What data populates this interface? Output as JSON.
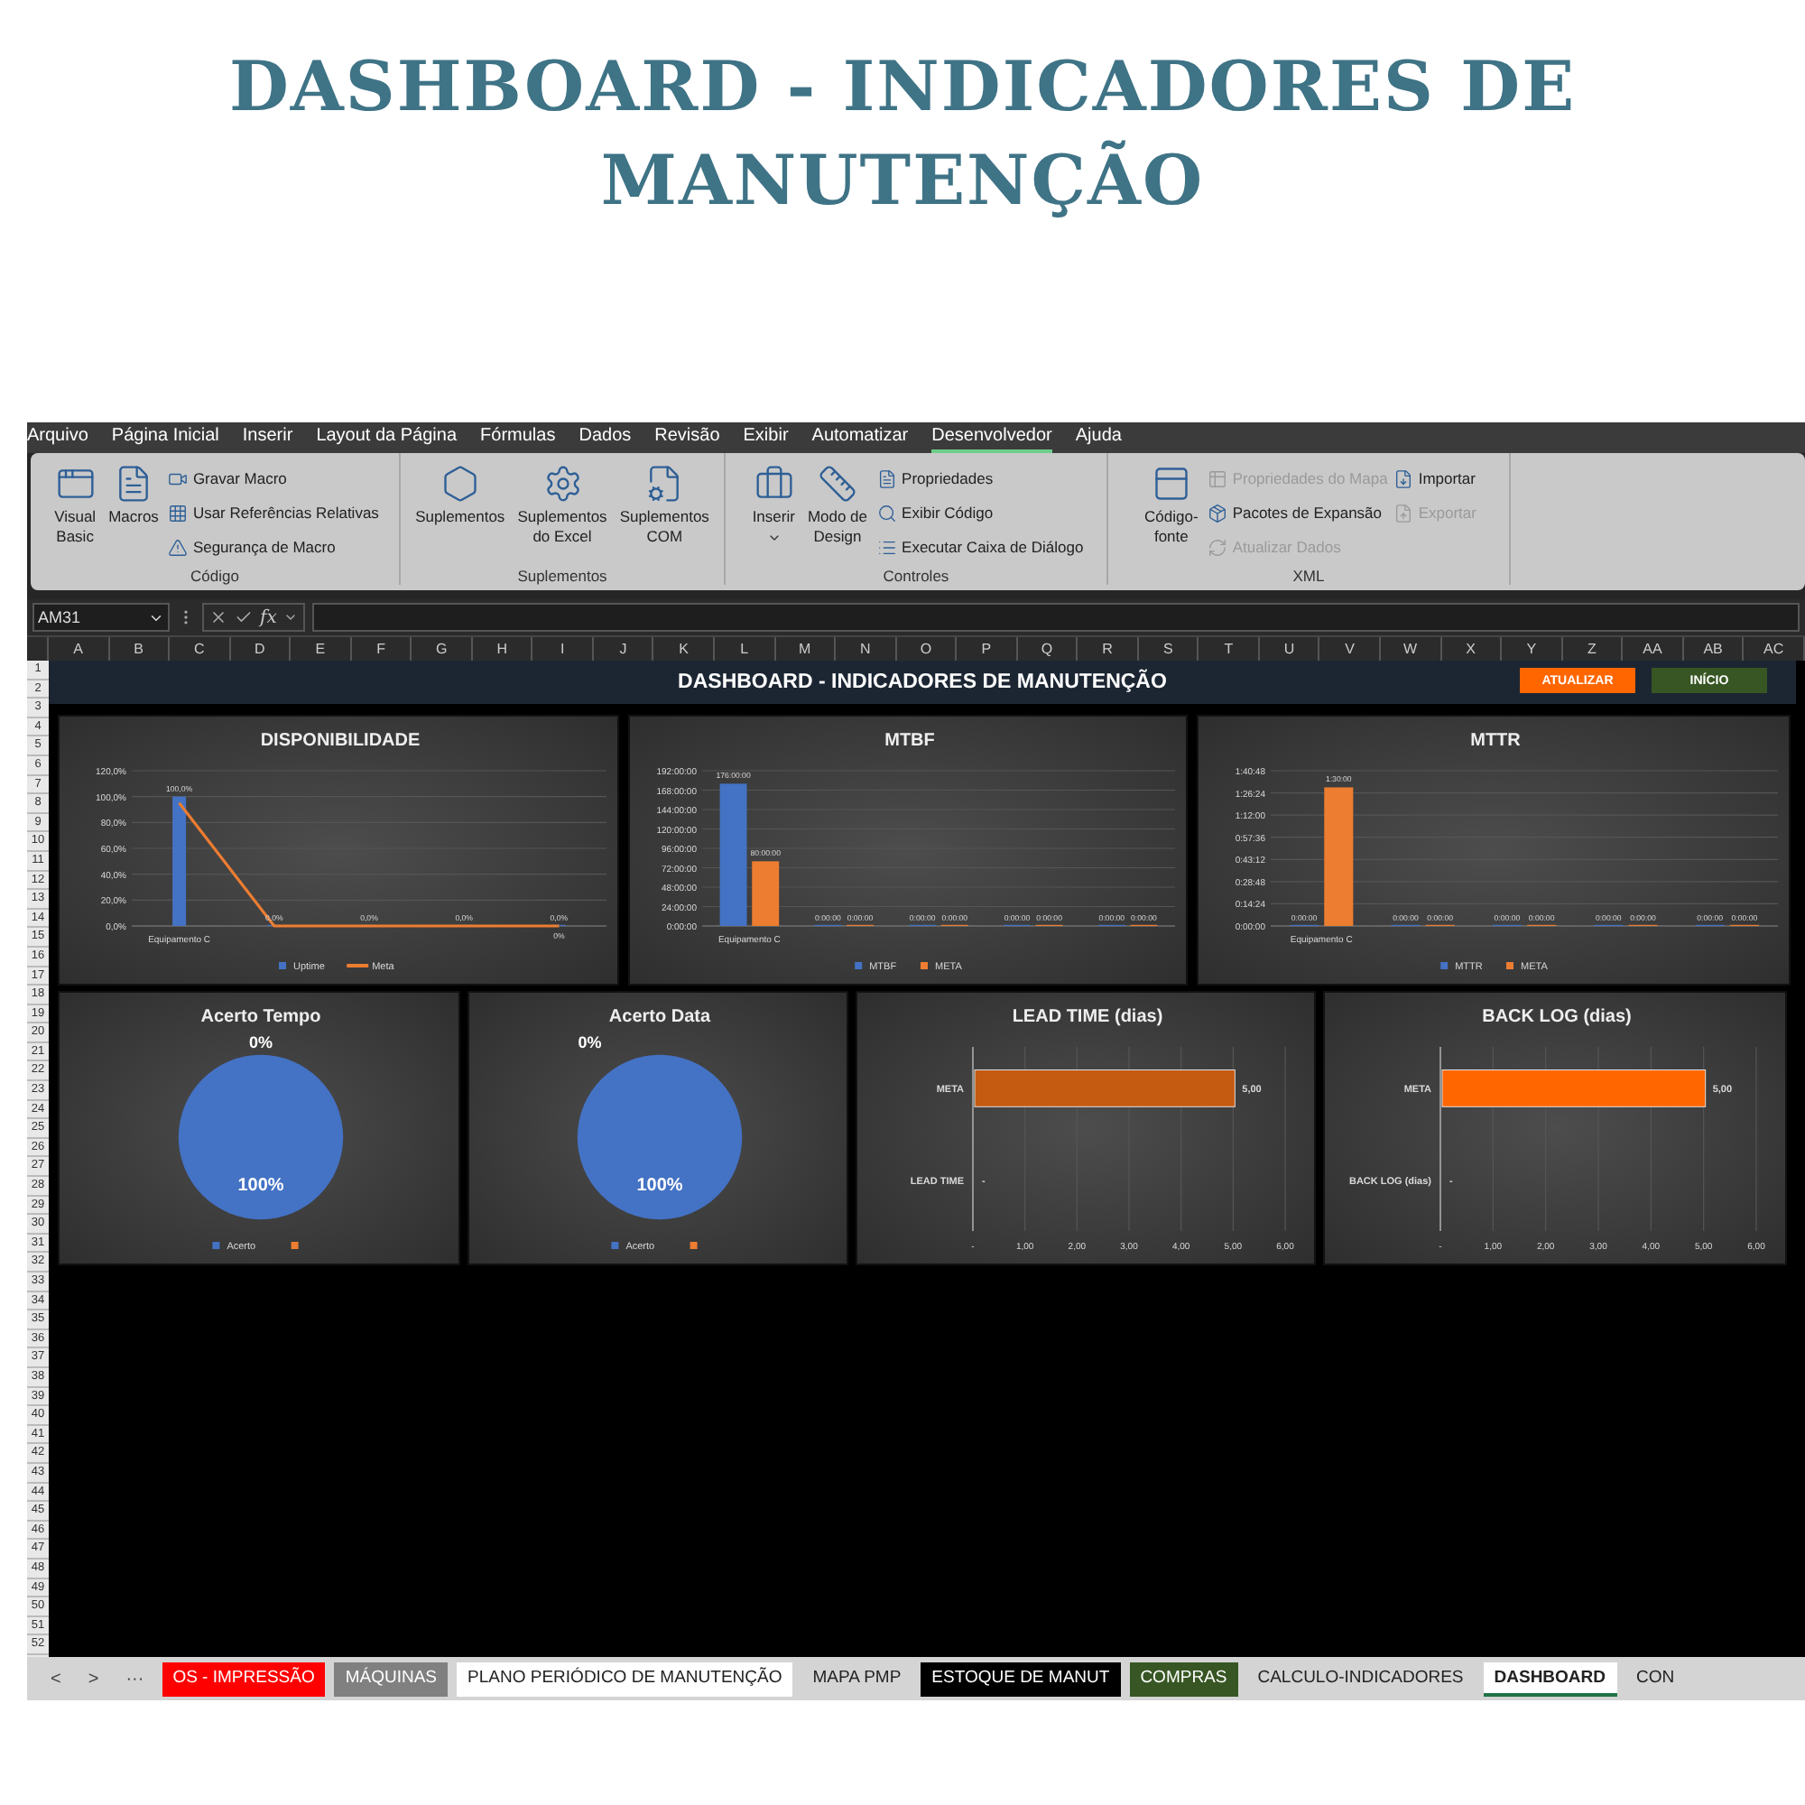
{
  "page_title": "DASHBOARD - INDICADORES DE MANUTENÇÃO",
  "menu_tabs": [
    {
      "label": "Arquivo",
      "selected": false
    },
    {
      "label": "Página Inicial",
      "selected": false
    },
    {
      "label": "Inserir",
      "selected": false
    },
    {
      "label": "Layout da Página",
      "selected": false
    },
    {
      "label": "Fórmulas",
      "selected": false
    },
    {
      "label": "Dados",
      "selected": false
    },
    {
      "label": "Revisão",
      "selected": false
    },
    {
      "label": "Exibir",
      "selected": false
    },
    {
      "label": "Automatizar",
      "selected": false
    },
    {
      "label": "Desenvolvedor",
      "selected": true
    },
    {
      "label": "Ajuda",
      "selected": false
    }
  ],
  "ribbon_groups": [
    {
      "label": "Código",
      "large": [
        {
          "label_lines": [
            "Visual",
            "Basic"
          ],
          "dropdown": false
        },
        {
          "label_lines": [
            "Macros"
          ],
          "dropdown": false
        }
      ],
      "small_columns": [
        [
          {
            "label": "Gravar Macro",
            "disabled": false
          },
          {
            "label": "Usar Referências Relativas",
            "disabled": false
          },
          {
            "label": "Segurança de Macro",
            "disabled": false
          }
        ]
      ]
    },
    {
      "label": "Suplementos",
      "large": [
        {
          "label_lines": [
            "Suplementos"
          ],
          "dropdown": false
        },
        {
          "label_lines": [
            "Suplementos",
            "do Excel"
          ],
          "dropdown": false
        },
        {
          "label_lines": [
            "Suplementos",
            "COM"
          ],
          "dropdown": false
        }
      ]
    },
    {
      "label": "Controles",
      "large": [
        {
          "label_lines": [
            "Inserir"
          ],
          "dropdown": true
        },
        {
          "label_lines": [
            "Modo de",
            "Design"
          ],
          "dropdown": false
        }
      ],
      "small_columns": [
        [
          {
            "label": "Propriedades",
            "disabled": false
          },
          {
            "label": "Exibir Código",
            "disabled": false
          },
          {
            "label": "Executar Caixa de Diálogo",
            "disabled": false
          }
        ]
      ]
    },
    {
      "label": "XML",
      "large": [
        {
          "label_lines": [
            "Código-",
            "fonte"
          ],
          "dropdown": false
        }
      ],
      "small_columns": [
        [
          {
            "label": "Propriedades do Mapa",
            "disabled": true
          },
          {
            "label": "Pacotes de Expansão",
            "disabled": false
          },
          {
            "label": "Atualizar Dados",
            "disabled": true
          }
        ],
        [
          {
            "label": "Importar",
            "disabled": false
          },
          {
            "label": "Exportar",
            "disabled": true
          }
        ]
      ]
    }
  ],
  "formula_bar": {
    "name_box": "AM31",
    "function_label": "fx"
  },
  "column_headers": [
    "A",
    "B",
    "C",
    "D",
    "E",
    "F",
    "G",
    "H",
    "I",
    "J",
    "K",
    "L",
    "M",
    "N",
    "O",
    "P",
    "Q",
    "R",
    "S",
    "T",
    "U",
    "V",
    "W",
    "X",
    "Y",
    "Z",
    "AA",
    "AB",
    "AC"
  ],
  "row_headers": [
    "1",
    "2",
    "3",
    "4",
    "5",
    "6",
    "7",
    "8",
    "9",
    "10",
    "11",
    "12",
    "13",
    "14",
    "15",
    "16",
    "17",
    "18",
    "19",
    "20",
    "21",
    "22",
    "23",
    "24",
    "25",
    "26",
    "27",
    "28",
    "29",
    "30",
    "31",
    "32",
    "33",
    "34",
    "35",
    "36",
    "37",
    "38",
    "39",
    "40",
    "41",
    "42",
    "43",
    "44",
    "45",
    "46",
    "47",
    "48",
    "49",
    "50",
    "51",
    "52"
  ],
  "sheet_title": "DASHBOARD - INDICADORES DE MANUTENÇÃO",
  "sheet_buttons": [
    {
      "label": "ATUALIZAR",
      "color": "#ff6600"
    },
    {
      "label": "INÍCIO",
      "color": "#375623"
    }
  ],
  "charts": [
    {
      "chart_data": {
        "type": "bar",
        "title": "DISPONIBILIDADE",
        "grid": true,
        "legend": "bottom",
        "categories": [
          "Equipamento C",
          null,
          null,
          null,
          null
        ],
        "ylim": [
          0,
          120
        ],
        "yticks": [
          {
            "value": 0,
            "label": "0,0%"
          },
          {
            "value": 20,
            "label": "20,0%"
          },
          {
            "value": 40,
            "label": "40,0%"
          },
          {
            "value": 60,
            "label": "60,0%"
          },
          {
            "value": 80,
            "label": "80,0%"
          },
          {
            "value": 100,
            "label": "100,0%"
          },
          {
            "value": 120,
            "label": "120,0%"
          }
        ],
        "series": [
          {
            "name": "Uptime",
            "type": "bar",
            "color": "#4472c4",
            "values": [
              100,
              0,
              0,
              0,
              0
            ],
            "value_labels": [
              "100,0%",
              "0,0%",
              "0,0%",
              "0,0%",
              "0,0%"
            ]
          },
          {
            "name": "Meta",
            "type": "line",
            "color": "#ed7d31",
            "values": [
              95,
              0,
              0,
              0,
              0
            ],
            "value_labels": [
              null,
              null,
              null,
              null,
              "0%"
            ]
          }
        ]
      }
    },
    {
      "chart_data": {
        "type": "bar",
        "title": "MTBF",
        "grid": true,
        "legend": "bottom",
        "categories": [
          "Equipamento C",
          null,
          null,
          null,
          null
        ],
        "ylim": [
          0,
          192
        ],
        "yticks": [
          {
            "value": 0,
            "label": "0:00:00"
          },
          {
            "value": 24,
            "label": "24:00:00"
          },
          {
            "value": 48,
            "label": "48:00:00"
          },
          {
            "value": 72,
            "label": "72:00:00"
          },
          {
            "value": 96,
            "label": "96:00:00"
          },
          {
            "value": 120,
            "label": "120:00:00"
          },
          {
            "value": 144,
            "label": "144:00:00"
          },
          {
            "value": 168,
            "label": "168:00:00"
          },
          {
            "value": 192,
            "label": "192:00:00"
          }
        ],
        "series": [
          {
            "name": "MTBF",
            "color": "#4472c4",
            "values": [
              176,
              0,
              0,
              0,
              0
            ],
            "value_labels": [
              "176:00:00",
              "0:00:00",
              "0:00:00",
              "0:00:00",
              "0:00:00"
            ]
          },
          {
            "name": "META",
            "color": "#ed7d31",
            "values": [
              80,
              0,
              0,
              0,
              0
            ],
            "value_labels": [
              "80:00:00",
              "0:00:00",
              "0:00:00",
              "0:00:00",
              "0:00:00"
            ]
          }
        ]
      }
    },
    {
      "chart_data": {
        "type": "bar",
        "title": "MTTR",
        "grid": true,
        "legend": "bottom",
        "categories": [
          "Equipamento C",
          null,
          null,
          null,
          null
        ],
        "ylim": [
          0,
          100.8
        ],
        "yticks": [
          {
            "value": 0,
            "label": "0:00:00"
          },
          {
            "value": 14.4,
            "label": "0:14:24"
          },
          {
            "value": 28.8,
            "label": "0:28:48"
          },
          {
            "value": 43.2,
            "label": "0:43:12"
          },
          {
            "value": 57.6,
            "label": "0:57:36"
          },
          {
            "value": 72,
            "label": "1:12:00"
          },
          {
            "value": 86.4,
            "label": "1:26:24"
          },
          {
            "value": 100.8,
            "label": "1:40:48"
          }
        ],
        "series": [
          {
            "name": "MTTR",
            "color": "#4472c4",
            "values": [
              0,
              0,
              0,
              0,
              0
            ],
            "value_labels": [
              "0:00:00",
              "0:00:00",
              "0:00:00",
              "0:00:00",
              "0:00:00"
            ]
          },
          {
            "name": "META",
            "color": "#ed7d31",
            "values": [
              90,
              0,
              0,
              0,
              0
            ],
            "value_labels": [
              "1:30:00",
              "0:00:00",
              "0:00:00",
              "0:00:00",
              "0:00:00"
            ]
          }
        ]
      }
    },
    {
      "chart_data": {
        "type": "pie",
        "title": "Acerto Tempo",
        "legend": "bottom",
        "categories": [
          "Acerto",
          null
        ],
        "values": [
          100,
          0
        ],
        "colors": [
          "#4472c4",
          "#ed7d31"
        ],
        "value_labels": [
          "100%",
          "0%"
        ]
      }
    },
    {
      "chart_data": {
        "type": "pie",
        "title": "Acerto Data",
        "legend": "bottom",
        "categories": [
          "Acerto",
          null
        ],
        "values": [
          100,
          0
        ],
        "colors": [
          "#4472c4",
          "#ed7d31"
        ],
        "value_labels": [
          "100%",
          "0%"
        ]
      }
    },
    {
      "chart_data": {
        "type": "bar",
        "orientation": "horizontal",
        "title": "LEAD TIME (dias)",
        "grid": true,
        "categories": [
          "META",
          "LEAD TIME"
        ],
        "xlim": [
          0,
          6
        ],
        "xticks": [
          {
            "value": 0,
            "label": "-"
          },
          {
            "value": 1,
            "label": "1,00"
          },
          {
            "value": 2,
            "label": "2,00"
          },
          {
            "value": 3,
            "label": "3,00"
          },
          {
            "value": 4,
            "label": "4,00"
          },
          {
            "value": 5,
            "label": "5,00"
          },
          {
            "value": 6,
            "label": "6,00"
          }
        ],
        "series": [
          {
            "color": "#c55a11",
            "values": [
              5,
              null
            ],
            "value_labels": [
              "5,00",
              "-"
            ]
          }
        ]
      }
    },
    {
      "chart_data": {
        "type": "bar",
        "orientation": "horizontal",
        "title": "BACK LOG (dias)",
        "grid": true,
        "categories": [
          "META",
          "BACK LOG (dias)"
        ],
        "xlim": [
          0,
          6
        ],
        "xticks": [
          {
            "value": 0,
            "label": "-"
          },
          {
            "value": 1,
            "label": "1,00"
          },
          {
            "value": 2,
            "label": "2,00"
          },
          {
            "value": 3,
            "label": "3,00"
          },
          {
            "value": 4,
            "label": "4,00"
          },
          {
            "value": 5,
            "label": "5,00"
          },
          {
            "value": 6,
            "label": "6,00"
          }
        ],
        "series": [
          {
            "color": "#ff6600",
            "values": [
              5,
              null
            ],
            "value_labels": [
              "5,00",
              "-"
            ]
          }
        ]
      }
    }
  ],
  "sheet_nav": [
    "<",
    ">",
    "···"
  ],
  "sheet_tabs": [
    {
      "label": "OS - IMPRESSÃO",
      "color": "#ff0000",
      "selected": false
    },
    {
      "label": "MÁQUINAS",
      "color": "#808080",
      "selected": false
    },
    {
      "label": "PLANO PERIÓDICO DE MANUTENÇÃO",
      "color": "#ffffff",
      "selected": false
    },
    {
      "label": "MAPA PMP",
      "selected": false
    },
    {
      "label": "ESTOQUE DE MANUT",
      "color": "#000000",
      "selected": false
    },
    {
      "label": "COMPRAS",
      "color": "#375623",
      "selected": false
    },
    {
      "label": "CALCULO-INDICADORES",
      "selected": false
    },
    {
      "label": "DASHBOARD",
      "selected": true
    },
    {
      "label": "CON",
      "selected": false
    }
  ]
}
